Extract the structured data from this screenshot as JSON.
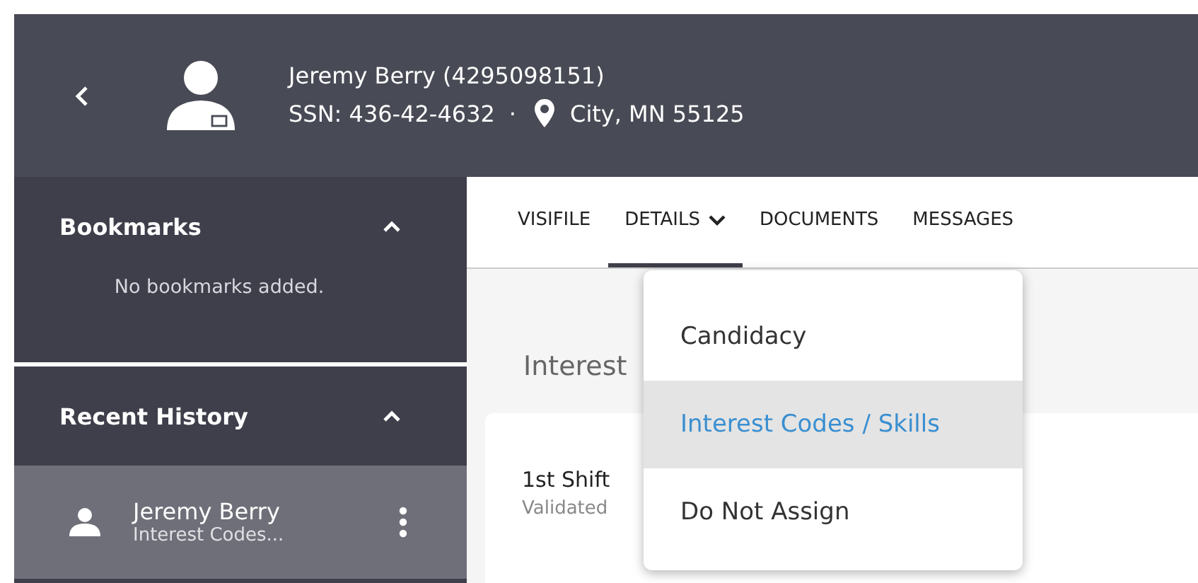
{
  "header": {
    "name": "Jeremy Berry (4295098151)",
    "ssn": "SSN: 436-42-4632",
    "separator": "·",
    "location": "City, MN 55125"
  },
  "sidebar": {
    "sections": [
      {
        "title": "Bookmarks",
        "expanded": true,
        "empty_text": "No bookmarks added."
      },
      {
        "title": "Recent History",
        "expanded": true,
        "items": [
          {
            "name": "Jeremy Berry",
            "subtitle": "Interest Codes...",
            "selected": true
          }
        ]
      }
    ]
  },
  "tabs": [
    {
      "label": "VISIFILE",
      "selected": false,
      "dropdown": false
    },
    {
      "label": "DETAILS",
      "selected": true,
      "dropdown": true
    },
    {
      "label": "DOCUMENTS",
      "selected": false,
      "dropdown": false
    },
    {
      "label": "MESSAGES",
      "selected": false,
      "dropdown": false
    }
  ],
  "menu": [
    {
      "label": "Candidacy",
      "selected": false
    },
    {
      "label": "Interest Codes / Skills",
      "selected": true
    },
    {
      "label": "Do Not Assign",
      "selected": false
    }
  ],
  "content": {
    "heading": "Interest",
    "card": {
      "title": "1st Shift",
      "subtitle": "Validated"
    }
  }
}
